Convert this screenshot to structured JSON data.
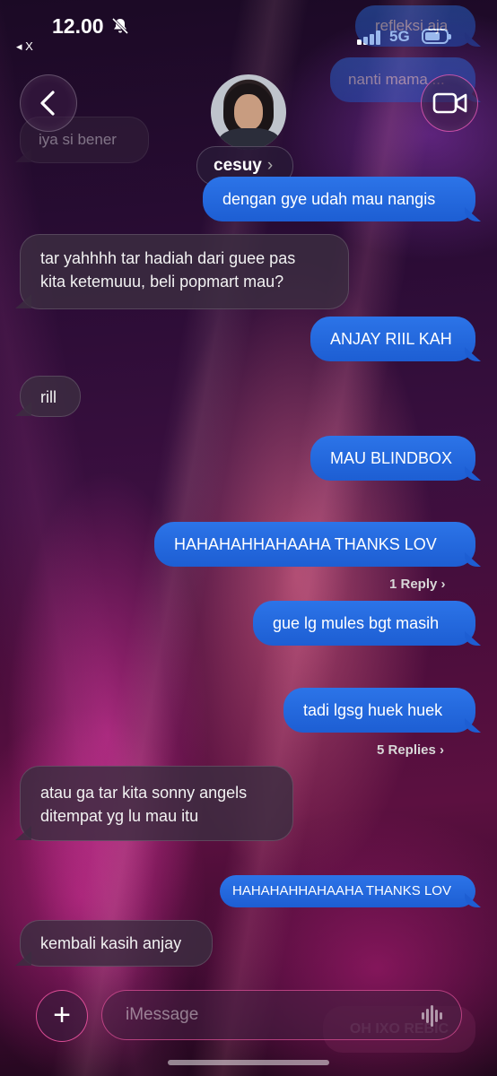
{
  "status_bar": {
    "time": "12.00",
    "back_app": "◂ X",
    "network": "5G"
  },
  "header": {
    "contact_name": "cesuy",
    "name_chevron": "›",
    "back_icon": "chevron-left-icon",
    "video_icon": "video-camera-icon"
  },
  "background_messages": [
    {
      "text": "refleksi aja",
      "side": "sent"
    },
    {
      "text": "nanti mama ...",
      "side": "sent"
    },
    {
      "text": "iya si bener",
      "side": "recv"
    }
  ],
  "messages": [
    {
      "side": "sent",
      "text": "dengan gye udah mau nangis"
    },
    {
      "side": "recv",
      "line1": "tar yahhhh tar hadiah dari guee pas",
      "line2": "kita ketemuuu, beli popmart mau?"
    },
    {
      "side": "sent",
      "text": "ANJAY RIIL KAH"
    },
    {
      "side": "recv",
      "text": "rill"
    },
    {
      "side": "sent",
      "text": "MAU BLINDBOX"
    },
    {
      "side": "sent",
      "text": "HAHAHAHHAHAAHA THANKS LOV",
      "replies": "1 Reply ›"
    },
    {
      "side": "sent",
      "text": "gue lg mules bgt masih"
    },
    {
      "side": "sent",
      "text": "tadi lgsg huek huek",
      "replies": "5 Replies ›"
    },
    {
      "side": "recv",
      "line1": "atau ga tar kita sonny angels",
      "line2": "ditempat yg lu mau itu"
    },
    {
      "side": "sent",
      "text": "HAHAHAHHAHAAHA THANKS LOV"
    },
    {
      "side": "recv",
      "text": "kembali kasih anjay"
    }
  ],
  "composer": {
    "plus_label": "+",
    "placeholder": "iMessage",
    "ghost_text": "OH IXO REBIC"
  },
  "colors": {
    "sent_bubble": "#2163dc",
    "received_bubble": "#3c2d41",
    "accent": "#ff5aaa"
  }
}
